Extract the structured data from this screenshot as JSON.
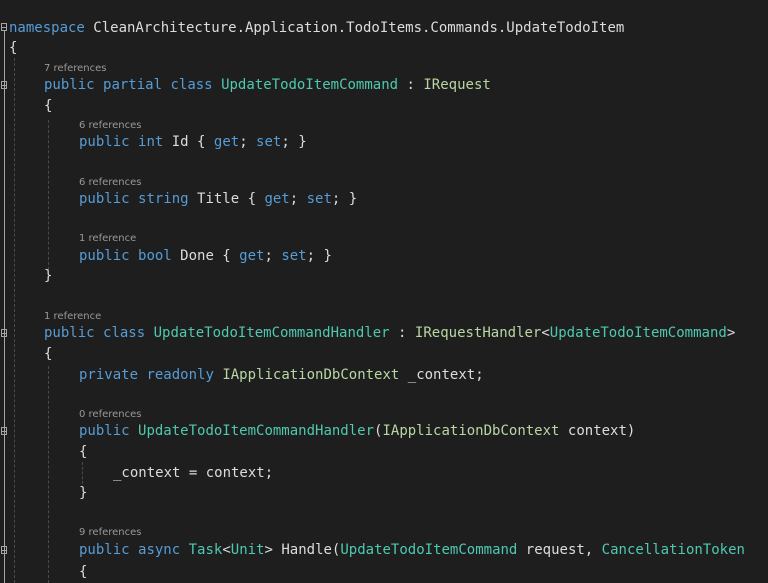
{
  "editor": {
    "namespace_line": {
      "keyword": "namespace",
      "name": " CleanArchitecture.Application.TodoItems.Commands.UpdateTodoItem"
    },
    "brace_open": "{",
    "command_class": {
      "lens": "7 references",
      "kw1": "public",
      "kw2": "partial",
      "kw3": "class",
      "name": "UpdateTodoItemCommand",
      "colon": " : ",
      "base": "IRequest",
      "brace_open": "{",
      "brace_close": "}",
      "id_prop": {
        "lens": "6 references",
        "kw": "public",
        "type": "int",
        "name": " Id { ",
        "get": "get",
        "sep": "; ",
        "set": "set",
        "end": "; }"
      },
      "title_prop": {
        "lens": "6 references",
        "kw": "public",
        "type": "string",
        "name": " Title { ",
        "get": "get",
        "sep": "; ",
        "set": "set",
        "end": "; }"
      },
      "done_prop": {
        "lens": "1 reference",
        "kw": "public",
        "type": "bool",
        "name": " Done { ",
        "get": "get",
        "sep": "; ",
        "set": "set",
        "end": "; }"
      }
    },
    "handler_class": {
      "lens": "1 reference",
      "kw1": "public",
      "kw2": "class",
      "name": "UpdateTodoItemCommandHandler",
      "colon": " : ",
      "base": "IRequestHandler",
      "lt": "<",
      "generic": "UpdateTodoItemCommand",
      "gt": ">",
      "brace_open": "{",
      "field": {
        "kw1": "private",
        "kw2": "readonly",
        "type": "IApplicationDbContext",
        "name": " _context;"
      },
      "ctor": {
        "lens": "0 references",
        "kw": "public",
        "name": "UpdateTodoItemCommandHandler",
        "paren": "(",
        "ptype": "IApplicationDbContext",
        "pname": " context)",
        "brace_open": "{",
        "body": "_context = context;",
        "brace_close": "}"
      },
      "handle": {
        "lens": "9 references",
        "kw1": "public",
        "kw2": "async",
        "rtype": "Task",
        "lt": "<",
        "rarg": "Unit",
        "gt": ">",
        "name": " Handle(",
        "ptype1": "UpdateTodoItemCommand",
        "pname1": " request, ",
        "ptype2": "CancellationToken",
        "brace_open": "{"
      }
    }
  },
  "colors": {
    "background": "#1e1e1e",
    "keyword": "#569cd6",
    "type": "#4ec9b0",
    "interface": "#b8d7a3",
    "text": "#dcdcdc",
    "codelens": "#999999"
  }
}
